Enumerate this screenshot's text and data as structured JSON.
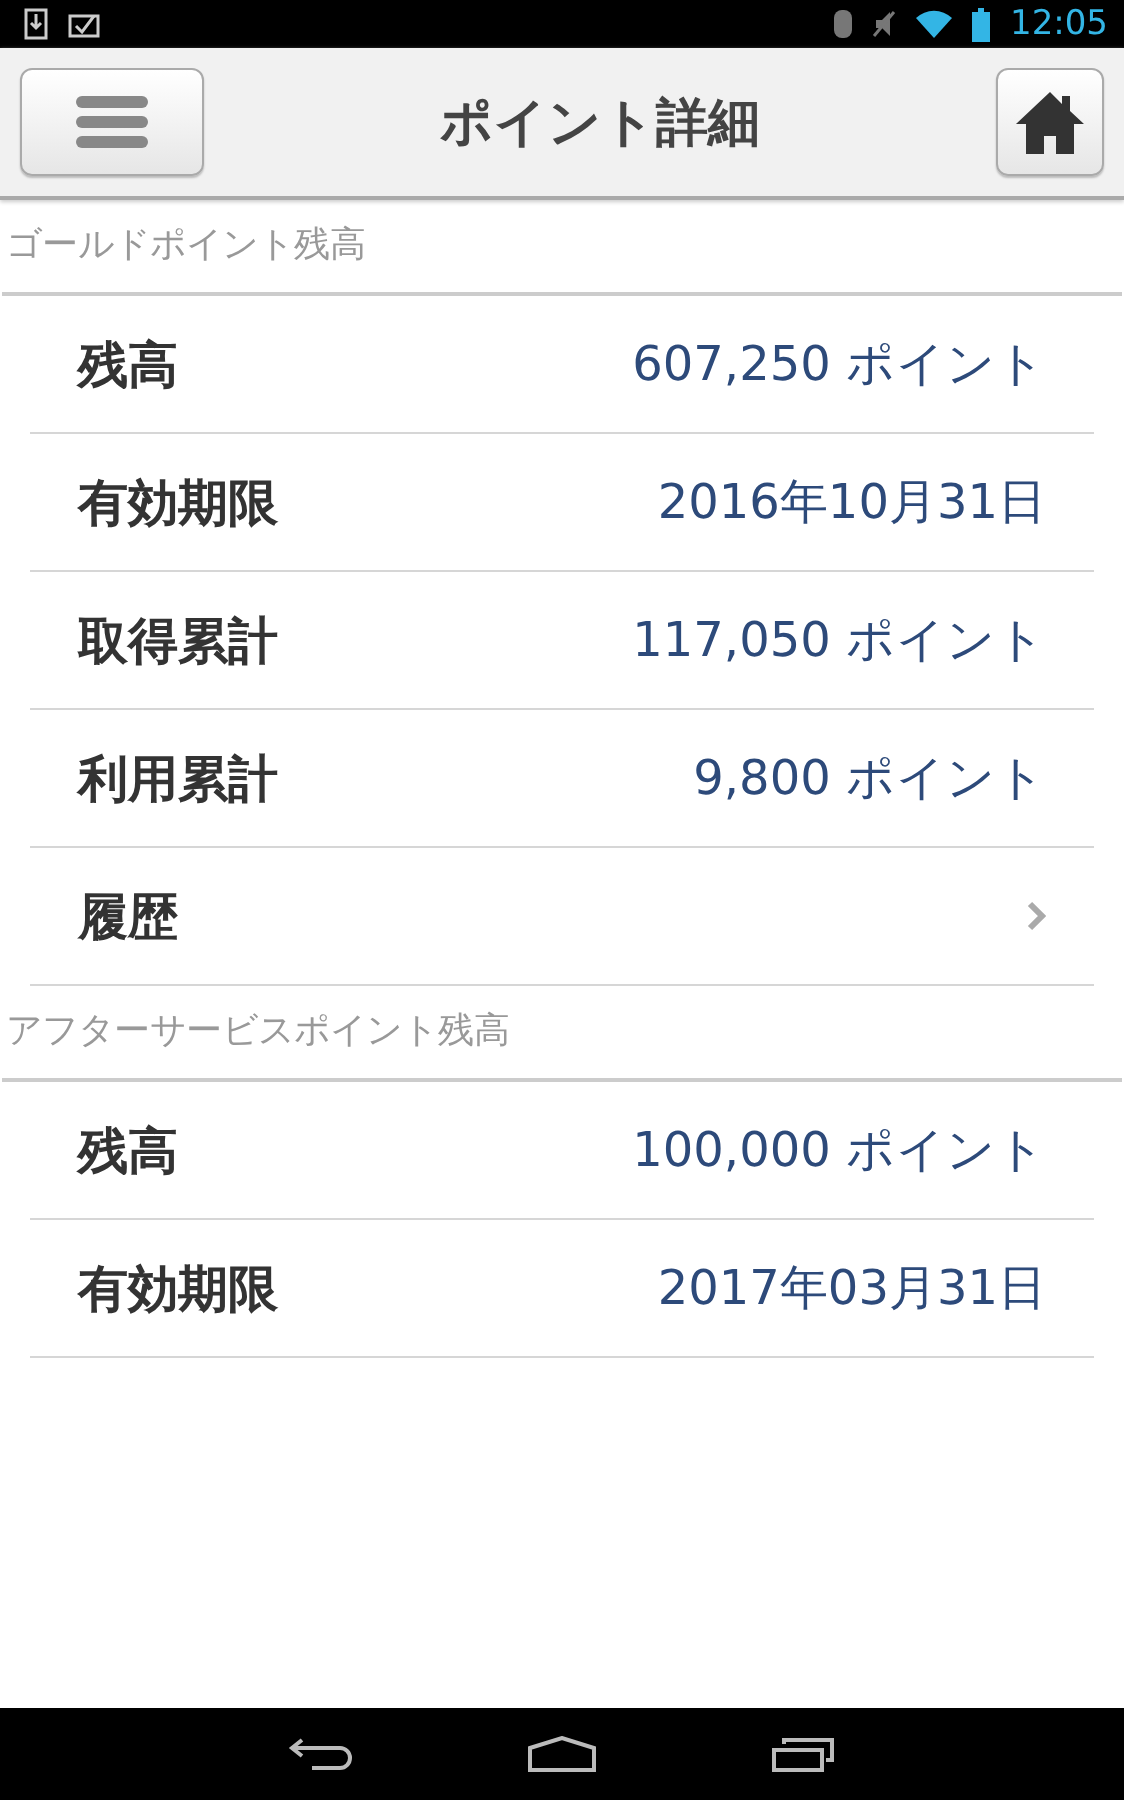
{
  "status_bar": {
    "time": "12:05"
  },
  "header": {
    "title": "ポイント詳細"
  },
  "sections": [
    {
      "title": "ゴールドポイント残高",
      "rows": [
        {
          "kind": "value",
          "label": "残高",
          "value": "607,250 ポイント"
        },
        {
          "kind": "value",
          "label": "有効期限",
          "value": "2016年10月31日"
        },
        {
          "kind": "value",
          "label": "取得累計",
          "value": "117,050 ポイント"
        },
        {
          "kind": "value",
          "label": "利用累計",
          "value": "9,800 ポイント"
        },
        {
          "kind": "link",
          "label": "履歴"
        }
      ]
    },
    {
      "title": "アフターサービスポイント残高",
      "rows": [
        {
          "kind": "value",
          "label": "残高",
          "value": "100,000 ポイント"
        },
        {
          "kind": "value",
          "label": "有効期限",
          "value": "2017年03月31日"
        }
      ]
    }
  ]
}
